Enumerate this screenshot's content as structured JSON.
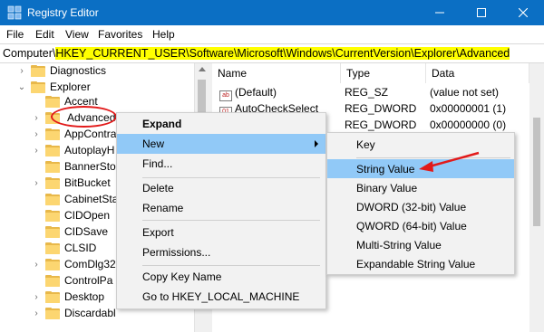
{
  "window": {
    "title": "Registry Editor"
  },
  "menubar": [
    "File",
    "Edit",
    "View",
    "Favorites",
    "Help"
  ],
  "address": {
    "prefix": "Computer\\",
    "path": "HKEY_CURRENT_USER\\Software\\Microsoft\\Windows\\CurrentVersion\\Explorer\\Advanced"
  },
  "tree": {
    "diagnostics": "Diagnostics",
    "explorer": "Explorer",
    "accent": "Accent",
    "advanced": "Advanced",
    "children": [
      "AppContra",
      "AutoplayH",
      "BannerStor",
      "BitBucket",
      "CabinetSta",
      "CIDOpen",
      "CIDSave",
      "CLSID",
      "ComDlg32",
      "ControlPa",
      "Desktop",
      "Discardabl"
    ]
  },
  "list": {
    "headers": {
      "name": "Name",
      "type": "Type",
      "data": "Data"
    },
    "rows": [
      {
        "name": "(Default)",
        "type": "REG_SZ",
        "data": "(value not set)"
      },
      {
        "name": "AutoCheckSelect",
        "type": "REG_DWORD",
        "data": "0x00000001 (1)"
      },
      {
        "name": "",
        "type": "REG_DWORD",
        "data": "0x00000000 (0)"
      }
    ]
  },
  "context_menu": {
    "expand": "Expand",
    "new": "New",
    "find": "Find...",
    "delete": "Delete",
    "rename": "Rename",
    "export": "Export",
    "permissions": "Permissions...",
    "copy_key_name": "Copy Key Name",
    "goto": "Go to HKEY_LOCAL_MACHINE"
  },
  "submenu": {
    "key": "Key",
    "string_value": "String Value",
    "binary_value": "Binary Value",
    "dword": "DWORD (32-bit) Value",
    "qword": "QWORD (64-bit) Value",
    "multi_string": "Multi-String Value",
    "expandable_string": "Expandable String Value"
  },
  "colors": {
    "titlebar": "#0b6fc4",
    "highlight": "#91c9f7",
    "annotation": "#e21a1a",
    "address_highlight": "#ffff00"
  }
}
